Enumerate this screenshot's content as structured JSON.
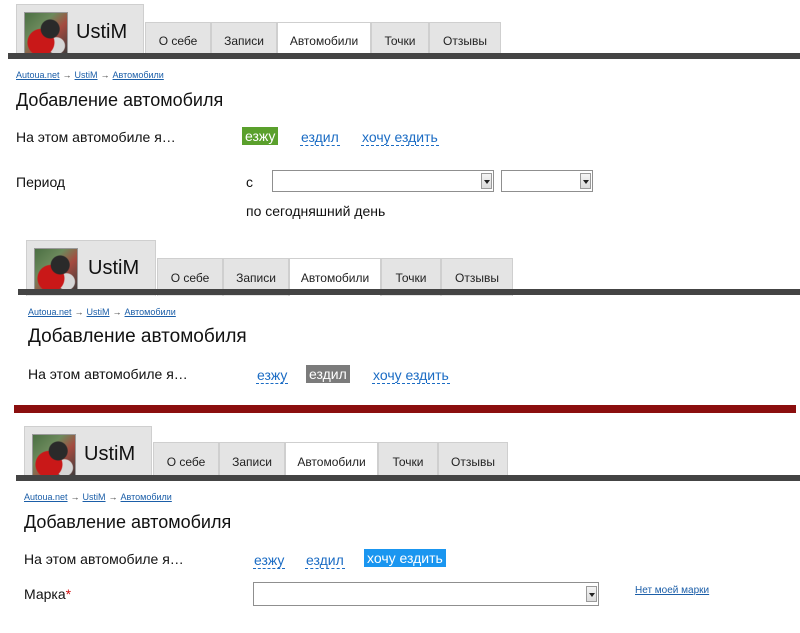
{
  "profile": {
    "name": "UstiM"
  },
  "tabs": [
    "О себе",
    "Записи",
    "Автомобили",
    "Точки",
    "Отзывы"
  ],
  "breadcrumb": {
    "site": "Autoua.net",
    "user": "UstiM",
    "section": "Автомобили",
    "arrow": "→"
  },
  "page_title": "Добавление автомобиля",
  "question": "На этом автомобиле я…",
  "options": [
    "езжу",
    "ездил",
    "хочу ездить"
  ],
  "period": {
    "label": "Период",
    "from": "с",
    "until": "по сегодняшний день"
  },
  "brand": {
    "label": "Марка",
    "required_mark": "*",
    "missing_link": "Нет моей марки"
  },
  "states": [
    {
      "selected_option": "езжу",
      "accent": "#5aa02c"
    },
    {
      "selected_option": "ездил",
      "accent": "#7b7b7b"
    },
    {
      "selected_option": "хочу ездить",
      "accent": "#1a96f0"
    }
  ],
  "colors": {
    "link": "#1b6cc4",
    "divider": "#8b0e0e",
    "tabbar": "#444444"
  }
}
